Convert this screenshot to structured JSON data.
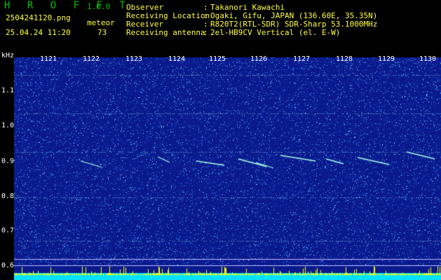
{
  "app": {
    "title": "H R O F F T",
    "version": "1.0.0"
  },
  "file": {
    "name": "2504241120.png",
    "datetime": "25.04.24 11:20",
    "mode": "meteor",
    "count": "73"
  },
  "info": [
    {
      "key": "Observer",
      "value": "Takanori Kawachi"
    },
    {
      "key": "Receiving Location",
      "value": "Ogaki, Gifu, JAPAN (136.60E, 35.35N)"
    },
    {
      "key": "Receiver",
      "value": "R820T2(RTL-SDR) SDR-Sharp 53.1000MHz"
    },
    {
      "key": "Receiving antenna",
      "value": "2el-HB9CV Vertical (el. E-W)"
    }
  ],
  "axis": {
    "y_unit": "kHz",
    "y_ticks": [
      "1.1",
      "1.0",
      "0.9",
      "0.8",
      "0.7",
      "0.6"
    ],
    "x_ticks": [
      "1121",
      "1122",
      "1123",
      "1124",
      "1125",
      "1126",
      "1127",
      "1128",
      "1129",
      "1130"
    ]
  },
  "colors": {
    "background": "#0a1a8c",
    "noise": "#3ea0ff",
    "trail": "#a8ffe8",
    "activity": "#ffff00",
    "baseline": "#00e0ff"
  }
}
